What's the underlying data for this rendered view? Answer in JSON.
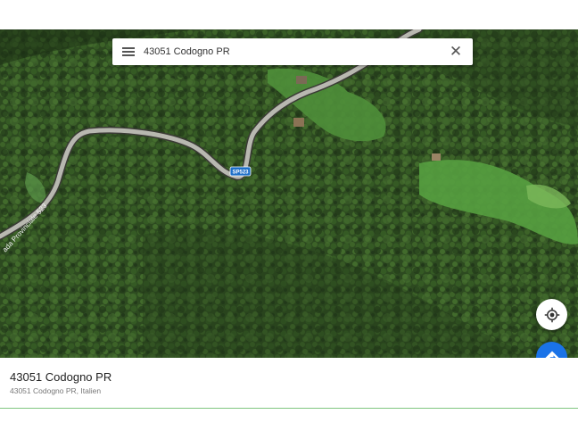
{
  "search": {
    "query": "43051 Codogno PR",
    "menu_icon": "menu-icon",
    "close_icon": "close-icon"
  },
  "map": {
    "road_badge": "SP523",
    "road_label": "ada Provinciale 523",
    "colors": {
      "forest": "#2f4a22",
      "meadow": "#4c9a3c",
      "road": "#b8b8b0"
    }
  },
  "controls": {
    "locate_icon": "my-location-icon",
    "directions_icon": "directions-icon",
    "accent": "#1a73e8"
  },
  "place": {
    "title": "43051 Codogno PR",
    "subtitle": "43051 Codogno PR, Italien"
  }
}
